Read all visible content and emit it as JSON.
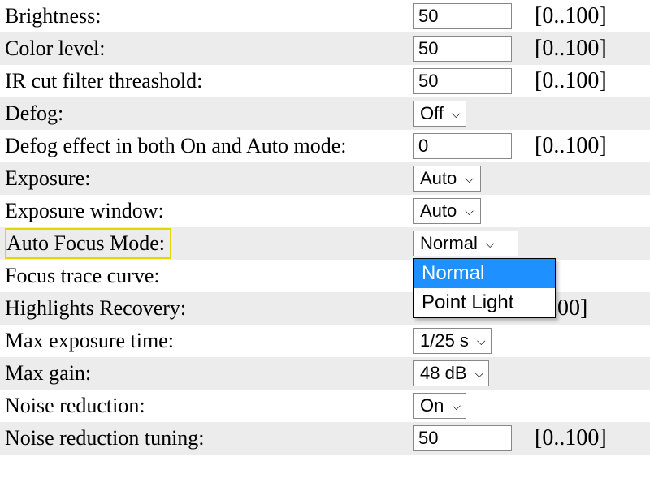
{
  "rows": {
    "brightness": {
      "label": "Brightness:",
      "value": "50",
      "range": "[0..100]"
    },
    "color_level": {
      "label": "Color level:",
      "value": "50",
      "range": "[0..100]"
    },
    "ir_cut": {
      "label": "IR cut filter threashold:",
      "value": "50",
      "range": "[0..100]"
    },
    "defog": {
      "label": "Defog:",
      "selected": "Off"
    },
    "defog_effect": {
      "label": "Defog effect in both On and Auto mode:",
      "value": "0",
      "range": "[0..100]"
    },
    "exposure": {
      "label": "Exposure:",
      "selected": "Auto"
    },
    "exposure_win": {
      "label": "Exposure window:",
      "selected": "Auto"
    },
    "af_mode": {
      "label": "Auto Focus Mode:",
      "selected": "Normal",
      "options": [
        "Normal",
        "Point Light"
      ]
    },
    "focus_trace": {
      "label": "Focus trace curve:"
    },
    "highlights": {
      "label": "Highlights Recovery:",
      "range_partial": "..100]"
    },
    "max_exp": {
      "label": "Max exposure time:",
      "selected": "1/25 s"
    },
    "max_gain": {
      "label": "Max gain:",
      "selected": "48 dB"
    },
    "noise_red": {
      "label": "Noise reduction:",
      "selected": "On"
    },
    "noise_tune": {
      "label": "Noise reduction tuning:",
      "value": "50",
      "range": "[0..100]"
    }
  }
}
